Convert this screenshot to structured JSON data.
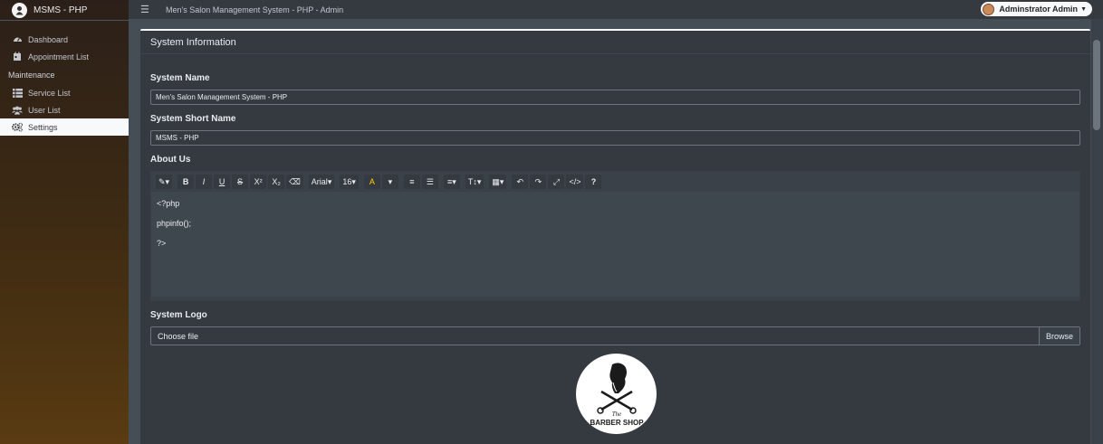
{
  "brand": {
    "name": "MSMS - PHP"
  },
  "sidebar": {
    "items": [
      {
        "label": "Dashboard",
        "icon": "dashboard-icon"
      },
      {
        "label": "Appointment List",
        "icon": "calendar-icon"
      }
    ],
    "section_header": "Maintenance",
    "maint_items": [
      {
        "label": "Service List",
        "icon": "list-icon"
      },
      {
        "label": "User List",
        "icon": "users-icon"
      },
      {
        "label": "Settings",
        "icon": "cogs-icon",
        "active": true
      }
    ]
  },
  "topbar": {
    "title": "Men's Salon Management System - PHP - Admin",
    "user": "Adminstrator Admin"
  },
  "card": {
    "title": "System Information",
    "system_name_label": "System Name",
    "system_name_value": "Men's Salon Management System - PHP",
    "short_name_label": "System Short Name",
    "short_name_value": "MSMS - PHP",
    "about_label": "About Us",
    "about_lines": [
      "<?php",
      "phpinfo();",
      "?>"
    ],
    "logo_label": "System Logo",
    "file_placeholder": "Choose file",
    "browse_label": "Browse"
  },
  "editor_toolbar": {
    "font_family": "Arial",
    "font_size": "16"
  },
  "logo": {
    "line1": "The",
    "line2": "BARBER SHOP"
  },
  "colors": {
    "sidebar_top": "#2b2019",
    "sidebar_bottom": "#5a3b12",
    "card_bg": "#343a40",
    "active_item_bg": "#f8f9fa"
  }
}
